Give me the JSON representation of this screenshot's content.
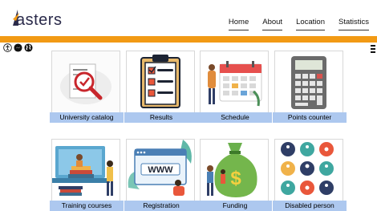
{
  "logo": {
    "text": "asters"
  },
  "nav": [
    {
      "label": "Home"
    },
    {
      "label": "About"
    },
    {
      "label": "Location"
    },
    {
      "label": "Statistics"
    }
  ],
  "colors": {
    "accent": "#f29a14",
    "label_bg": "#adc8ef"
  },
  "toolbar": [
    {
      "icon": "accessibility-icon"
    },
    {
      "icon": "messenger-icon"
    },
    {
      "icon": "globe-icon"
    }
  ],
  "tiles": [
    {
      "label": "University catalog",
      "icon": "catalog-search-icon"
    },
    {
      "label": "Results",
      "icon": "clipboard-checklist-icon"
    },
    {
      "label": "Schedule",
      "icon": "calendar-icon"
    },
    {
      "label": "Points counter",
      "icon": "calculator-icon"
    },
    {
      "label": "Training courses",
      "icon": "training-laptop-icon"
    },
    {
      "label": "Registration",
      "icon": "www-browser-icon"
    },
    {
      "label": "Funding",
      "icon": "money-bag-icon"
    },
    {
      "label": "Disabled person",
      "icon": "disability-icons"
    }
  ]
}
